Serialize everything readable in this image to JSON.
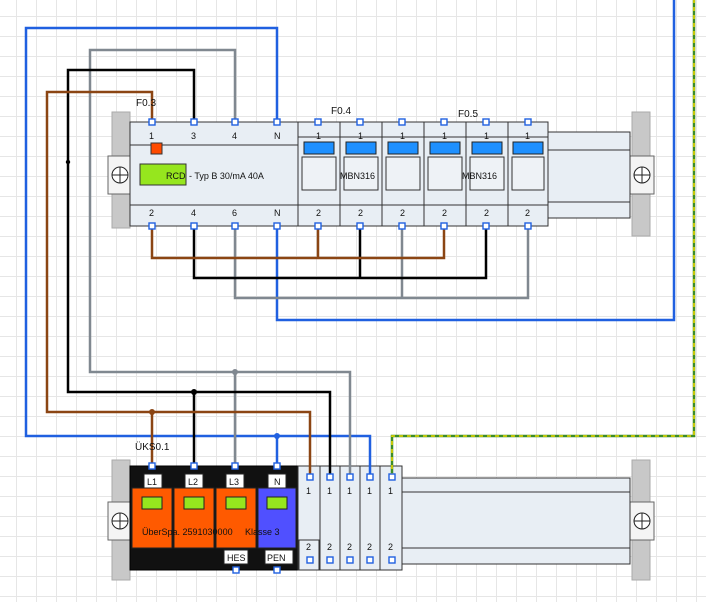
{
  "labels": {
    "f03": "F0.3",
    "f04": "F0.4",
    "f05": "F0.5",
    "uks": "ÜKS0.1",
    "rcd_name": "RCD",
    "rcd_desc": "- Typ B 30/mA 40A",
    "mbn_a": "MBN316",
    "mbn_b": "MBN316",
    "spd_desc": "ÜberSpa. 2591030000",
    "spd_class": "Klasse 3",
    "hes": "HES",
    "pen": "PEN"
  },
  "rcd_terms": {
    "top": [
      "1",
      "3",
      "4",
      "N"
    ],
    "bottom": [
      "2",
      "4",
      "6",
      "N"
    ]
  },
  "mcb_terms": {
    "top": "1",
    "bottom": "2"
  },
  "spd_terms": [
    "L1",
    "L2",
    "L3",
    "N"
  ],
  "term_block": {
    "top": "1",
    "bottom": "2"
  },
  "colors": {
    "brown": "#8b4513",
    "black": "#000000",
    "grey": "#808890",
    "blue": "#2060e0",
    "pe_green": "#3c8c28",
    "pe_yellow": "#e8d800",
    "spd_orange": "#ff5a00",
    "spd_blue": "#5050ff",
    "indicator_green": "#96e61e",
    "mcb_blue": "#1e90ff"
  }
}
